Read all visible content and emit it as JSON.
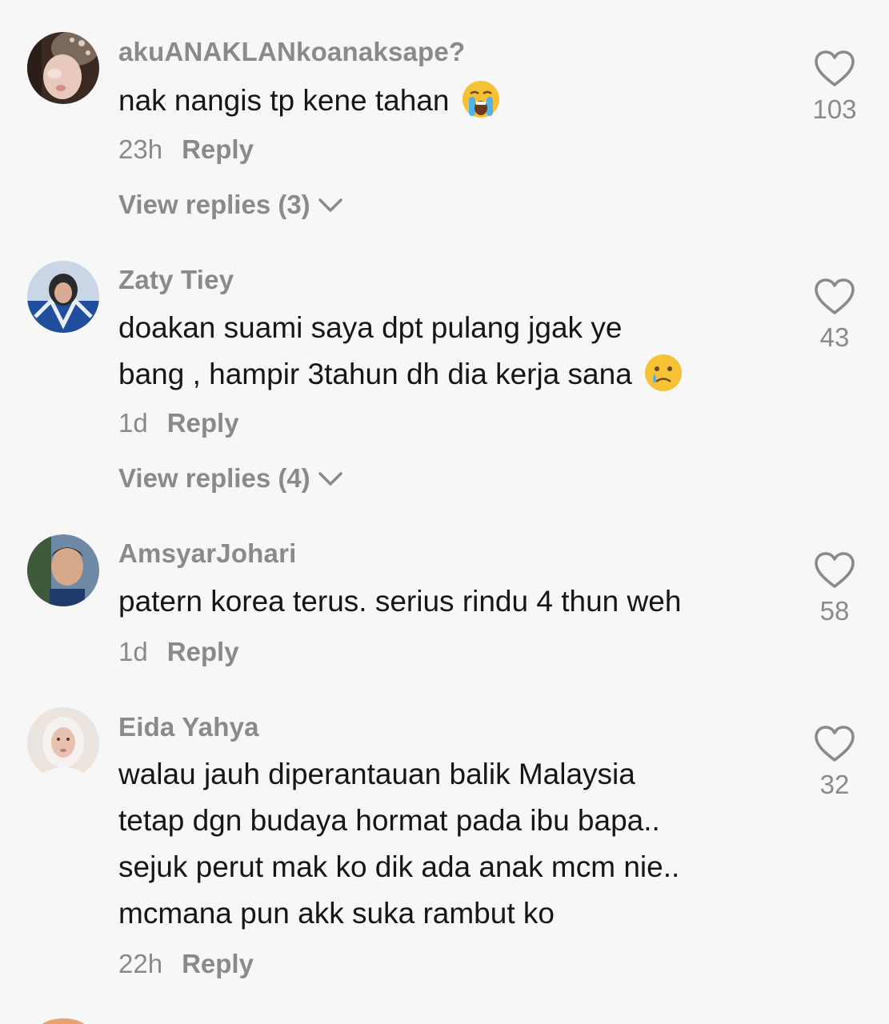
{
  "comments": [
    {
      "username": "akuANAKLANkoanaksape?",
      "text_lines": [
        "nak nangis tp kene tahan"
      ],
      "emoji": "loudly-crying-face-emoji",
      "time": "23h",
      "reply_label": "Reply",
      "view_replies": "View replies (3)",
      "likes": "103"
    },
    {
      "username": "Zaty Tiey",
      "text_lines": [
        "doakan suami saya dpt pulang jgak ye",
        "bang , hampir 3tahun dh dia kerja sana"
      ],
      "emoji": "crying-face-emoji",
      "time": "1d",
      "reply_label": "Reply",
      "view_replies": "View replies (4)",
      "likes": "43"
    },
    {
      "username": "AmsyarJohari",
      "text_lines": [
        "patern korea terus. serius rindu 4 thun weh"
      ],
      "time": "1d",
      "reply_label": "Reply",
      "likes": "58"
    },
    {
      "username": "Eida Yahya",
      "text_lines": [
        "walau jauh diperantauan balik Malaysia",
        "tetap dgn budaya hormat pada ibu bapa..",
        "sejuk perut mak ko dik ada anak mcm nie..",
        "mcmana pun akk suka rambut ko"
      ],
      "time": "22h",
      "reply_label": "Reply",
      "likes": "32"
    }
  ],
  "icons": {
    "like": "heart-outline-icon",
    "expand": "chevron-down-icon"
  },
  "colors": {
    "background": "#f7f7f7",
    "secondary_text": "#8a8a8a",
    "primary_text": "#161616"
  }
}
